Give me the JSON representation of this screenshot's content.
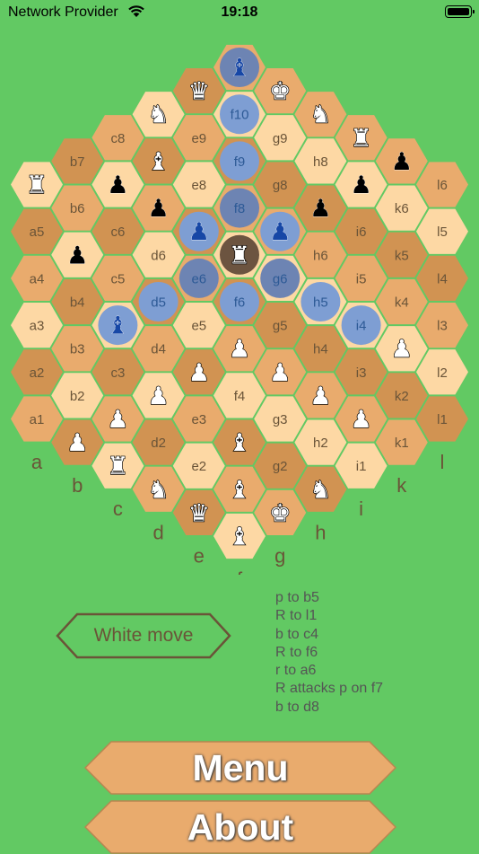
{
  "status_bar": {
    "carrier": "Network Provider",
    "time": "19:18"
  },
  "colors": {
    "background": "#62c963",
    "hex_light": "#fdd8a4",
    "hex_mid": "#e9ab6d",
    "hex_dark": "#d19352",
    "highlight": "#7e9ed3",
    "highlight_dark": "#6d84b3",
    "selected": "#6c5440",
    "label": "#6a5438",
    "white_piece": "#ffffff",
    "black_piece": "#000000",
    "blue_piece": "#1747a6"
  },
  "board": {
    "files": [
      "a",
      "b",
      "c",
      "d",
      "e",
      "f",
      "g",
      "h",
      "i",
      "k",
      "l"
    ],
    "cells": [
      {
        "id": "f11",
        "piece": "♝",
        "side": "blue",
        "mark": "dark"
      },
      {
        "id": "e10",
        "piece": "♛",
        "side": "white"
      },
      {
        "id": "g10",
        "piece": "♚",
        "side": "white"
      },
      {
        "id": "d9",
        "piece": "♞",
        "side": "white"
      },
      {
        "id": "f10",
        "label": "f10",
        "mark": "light"
      },
      {
        "id": "h9",
        "piece": "♞",
        "side": "white"
      },
      {
        "id": "c8",
        "label": "c8"
      },
      {
        "id": "e9",
        "label": "e9"
      },
      {
        "id": "g9",
        "label": "g9"
      },
      {
        "id": "i8",
        "piece": "♜",
        "side": "white"
      },
      {
        "id": "b7",
        "label": "b7"
      },
      {
        "id": "d8",
        "piece": "♝",
        "side": "white"
      },
      {
        "id": "f9",
        "label": "f9",
        "mark": "light"
      },
      {
        "id": "h8",
        "label": "h8"
      },
      {
        "id": "k7",
        "piece": "♟",
        "side": "black"
      },
      {
        "id": "a6",
        "piece": "♜",
        "side": "white"
      },
      {
        "id": "c7",
        "piece": "♟",
        "side": "black"
      },
      {
        "id": "e8",
        "label": "e8"
      },
      {
        "id": "g8",
        "label": "g8"
      },
      {
        "id": "i7",
        "piece": "♟",
        "side": "black"
      },
      {
        "id": "l6",
        "label": "l6"
      },
      {
        "id": "b6",
        "label": "b6"
      },
      {
        "id": "d7",
        "piece": "♟",
        "side": "black"
      },
      {
        "id": "f8",
        "label": "f8",
        "mark": "dark"
      },
      {
        "id": "h7",
        "piece": "♟",
        "side": "black"
      },
      {
        "id": "k6",
        "label": "k6"
      },
      {
        "id": "a5",
        "label": "a5"
      },
      {
        "id": "c6",
        "label": "c6"
      },
      {
        "id": "e7",
        "piece": "♟",
        "side": "blue",
        "mark": "light"
      },
      {
        "id": "g7",
        "piece": "♟",
        "side": "blue",
        "mark": "light"
      },
      {
        "id": "i6",
        "label": "i6"
      },
      {
        "id": "l5",
        "label": "l5"
      },
      {
        "id": "b5",
        "piece": "♟",
        "side": "black"
      },
      {
        "id": "d6",
        "label": "d6"
      },
      {
        "id": "f7",
        "piece": "♜",
        "side": "white",
        "mark": "selected"
      },
      {
        "id": "h6",
        "label": "h6"
      },
      {
        "id": "k5",
        "label": "k5"
      },
      {
        "id": "a4",
        "label": "a4"
      },
      {
        "id": "c5",
        "label": "c5"
      },
      {
        "id": "e6",
        "label": "e6",
        "mark": "dark"
      },
      {
        "id": "g6",
        "label": "g6",
        "mark": "dark"
      },
      {
        "id": "i5",
        "label": "i5"
      },
      {
        "id": "l4",
        "label": "l4"
      },
      {
        "id": "b4",
        "label": "b4"
      },
      {
        "id": "d5",
        "label": "d5",
        "mark": "light"
      },
      {
        "id": "f6",
        "label": "f6",
        "mark": "light"
      },
      {
        "id": "h5",
        "label": "h5",
        "mark": "light"
      },
      {
        "id": "k4",
        "label": "k4"
      },
      {
        "id": "a3",
        "label": "a3"
      },
      {
        "id": "c4",
        "piece": "♝",
        "side": "blue",
        "mark": "light"
      },
      {
        "id": "e5",
        "label": "e5"
      },
      {
        "id": "g5",
        "label": "g5"
      },
      {
        "id": "i4",
        "label": "i4",
        "mark": "light"
      },
      {
        "id": "l3",
        "label": "l3"
      },
      {
        "id": "b3",
        "label": "b3"
      },
      {
        "id": "d4",
        "label": "d4"
      },
      {
        "id": "f5",
        "piece": "♟",
        "side": "white"
      },
      {
        "id": "h4",
        "label": "h4"
      },
      {
        "id": "k3",
        "piece": "♟",
        "side": "white"
      },
      {
        "id": "a2",
        "label": "a2"
      },
      {
        "id": "c3",
        "label": "c3"
      },
      {
        "id": "e4",
        "piece": "♟",
        "side": "white"
      },
      {
        "id": "g4",
        "piece": "♟",
        "side": "white"
      },
      {
        "id": "i3",
        "label": "i3"
      },
      {
        "id": "l2",
        "label": "l2"
      },
      {
        "id": "b2",
        "label": "b2"
      },
      {
        "id": "d3",
        "piece": "♟",
        "side": "white"
      },
      {
        "id": "f4",
        "label": "f4"
      },
      {
        "id": "h3",
        "piece": "♟",
        "side": "white"
      },
      {
        "id": "k2",
        "label": "k2"
      },
      {
        "id": "a1",
        "label": "a1"
      },
      {
        "id": "c2",
        "piece": "♟",
        "side": "white"
      },
      {
        "id": "e3",
        "label": "e3"
      },
      {
        "id": "g3",
        "label": "g3"
      },
      {
        "id": "i2",
        "piece": "♟",
        "side": "white"
      },
      {
        "id": "l1",
        "label": "l1"
      },
      {
        "id": "b1",
        "piece": "♟",
        "side": "white"
      },
      {
        "id": "d2",
        "label": "d2"
      },
      {
        "id": "f3",
        "piece": "♝",
        "side": "white"
      },
      {
        "id": "h2",
        "label": "h2"
      },
      {
        "id": "k1",
        "label": "k1"
      },
      {
        "id": "c1",
        "piece": "♜",
        "side": "white"
      },
      {
        "id": "e2",
        "label": "e2"
      },
      {
        "id": "g2",
        "label": "g2"
      },
      {
        "id": "i1",
        "label": "i1"
      },
      {
        "id": "d1",
        "piece": "♞",
        "side": "white"
      },
      {
        "id": "f2",
        "piece": "♝",
        "side": "white"
      },
      {
        "id": "h1",
        "piece": "♞",
        "side": "white"
      },
      {
        "id": "e1",
        "piece": "♛",
        "side": "white"
      },
      {
        "id": "g1",
        "piece": "♚",
        "side": "white"
      },
      {
        "id": "f1",
        "piece": "♝",
        "side": "white"
      }
    ]
  },
  "turn_button": {
    "label": "White move"
  },
  "move_log": [
    "p to b5",
    "R to l1",
    "b to c4",
    "R to f6",
    "r to a6",
    "R attacks p on  f7",
    "b to d8"
  ],
  "buttons": {
    "menu": "Menu",
    "about": "About"
  }
}
